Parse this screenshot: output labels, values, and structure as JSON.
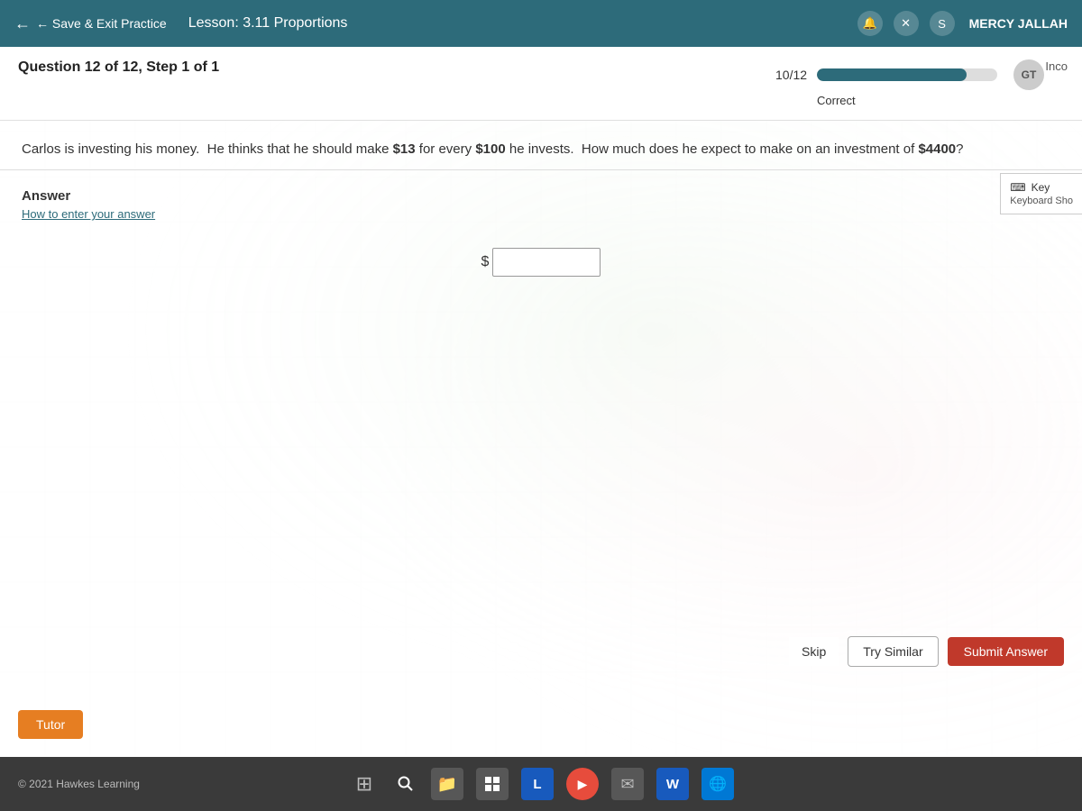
{
  "topNav": {
    "back_label": "← Save & Exit Practice",
    "lesson_label": "Lesson: 3.11 Proportions",
    "user_name": "MERCY JALLAH",
    "icons": [
      "bell",
      "x",
      "s"
    ]
  },
  "questionHeader": {
    "label": "Question 12 of 12,  Step 1 of 1",
    "progress_count": "10/12",
    "progress_label": "Correct",
    "progress_percent": 83,
    "incorrect_label": "Inco"
  },
  "questionText": "Carlos is investing his money.  He thinks that he should make $13 for every $100 he invests.  How much does he expect to make on an investment of $4400?",
  "answer": {
    "label": "Answer",
    "how_to_enter": "How to enter your answer",
    "dollar_sign": "$",
    "input_placeholder": "",
    "keyboard_label": "Key",
    "keyboard_shortcut_label": "Keyboard Sho"
  },
  "buttons": {
    "skip": "Skip",
    "try_similar": "Try Similar",
    "submit": "Submit Answer",
    "tutor": "Tutor"
  },
  "footer": {
    "copyright": "© 2021 Hawkes Learning"
  }
}
